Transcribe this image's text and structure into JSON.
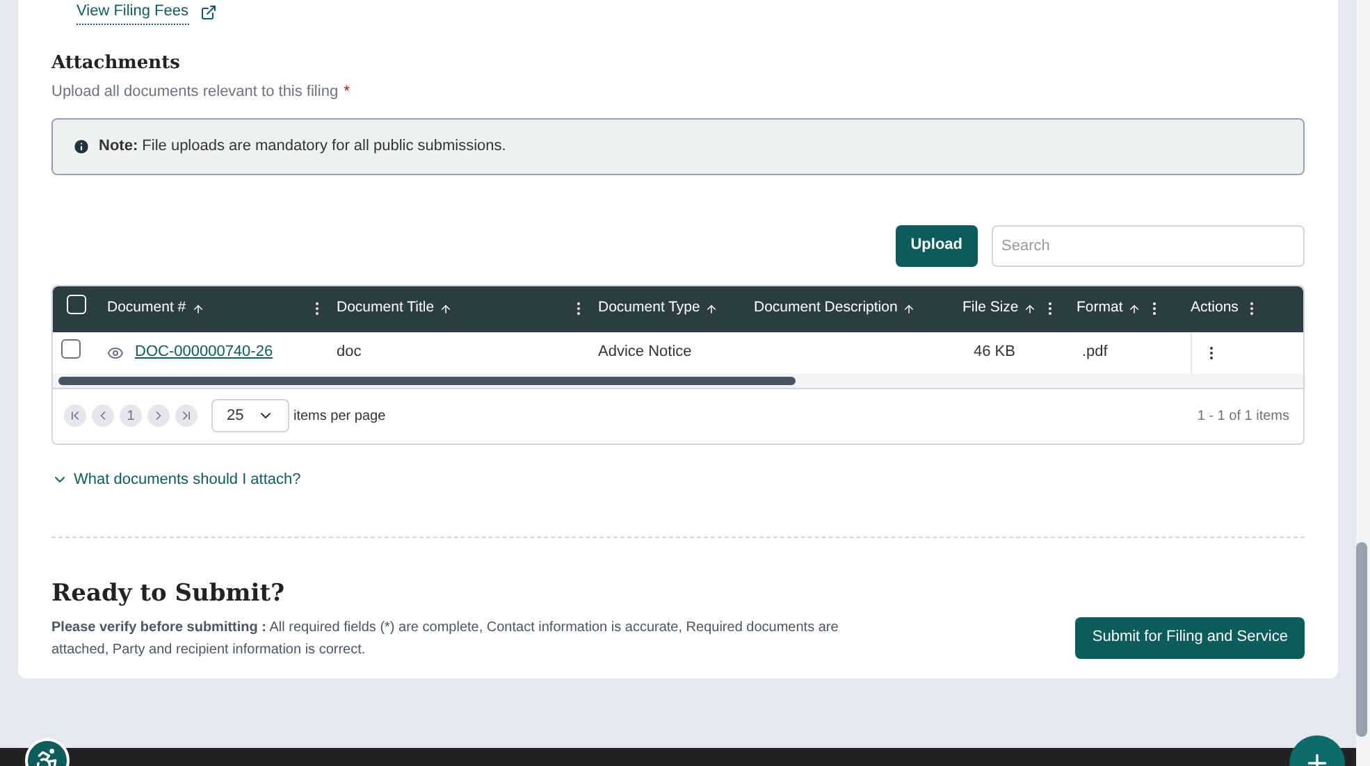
{
  "fees_link": "View Filing Fees",
  "attachments": {
    "title": "Attachments",
    "subtitle": "Upload all documents relevant to this filing",
    "required_mark": "*",
    "note": "**Note:** File uploads are mandatory for all public submissions."
  },
  "toolbar": {
    "upload": "Upload",
    "search_placeholder": "Search"
  },
  "table": {
    "columns": [
      {
        "label": "Document #",
        "sortable": true,
        "menu": true
      },
      {
        "label": "Document Title",
        "sortable": true,
        "menu": true
      },
      {
        "label": "Document Type",
        "sortable": true,
        "menu": false
      },
      {
        "label": "Document Description",
        "sortable": true,
        "menu": false
      },
      {
        "label": "File Size",
        "sortable": true,
        "menu": true
      },
      {
        "label": "Format",
        "sortable": true,
        "menu": true
      },
      {
        "label": "Actions",
        "sortable": false,
        "menu": true
      }
    ],
    "header_checked": false,
    "rows": [
      {
        "checked": false,
        "doc_number": "DOC-000000740-26",
        "title": "doc",
        "type": "Advice Notice",
        "description": "",
        "size": "46 KB",
        "format": ".pdf"
      }
    ]
  },
  "pager": {
    "page": "1",
    "page_size": "25",
    "page_size_label": "items per page",
    "summary": "1 - 1 of 1 items"
  },
  "help_link": "What documents should I attach?",
  "submit": {
    "title": "Ready to Submit?",
    "text": "**Please verify before submitting :** All required fields (*) are complete, Contact information is accurate, Required documents are attached, Party and recipient information is correct.",
    "button": "Submit for Filing and Service"
  }
}
